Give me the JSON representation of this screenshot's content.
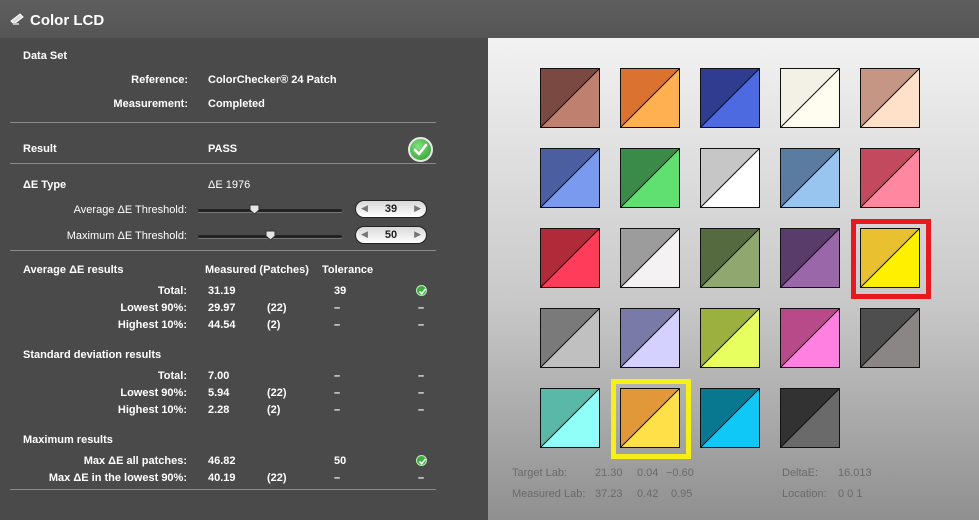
{
  "window": {
    "title": "Color LCD"
  },
  "dataset": {
    "header": "Data Set",
    "reference_label": "Reference:",
    "reference_value": "ColorChecker® 24 Patch",
    "measurement_label": "Measurement:",
    "measurement_value": "Completed"
  },
  "result": {
    "label": "Result",
    "value": "PASS"
  },
  "delta_e": {
    "type_label": "ΔE Type",
    "type_value": "ΔE 1976",
    "avg_threshold_label": "Average  ΔE Threshold:",
    "avg_threshold_value": "39",
    "avg_slider_fraction": 0.39,
    "max_threshold_label": "Maximum ΔE Threshold:",
    "max_threshold_value": "50",
    "max_slider_fraction": 0.5
  },
  "average": {
    "header": "Average ΔE results",
    "col_measured": "Measured (Patches)",
    "col_tolerance": "Tolerance",
    "rows": [
      {
        "label": "Total:",
        "measured": "31.19",
        "patches": "",
        "tolerance": "39",
        "status": "check"
      },
      {
        "label": "Lowest 90%:",
        "measured": "29.97",
        "patches": "(22)",
        "tolerance": "–",
        "status": "–"
      },
      {
        "label": "Highest 10%:",
        "measured": "44.54",
        "patches": "(2)",
        "tolerance": "–",
        "status": "–"
      }
    ]
  },
  "stddev": {
    "header": "Standard deviation results",
    "rows": [
      {
        "label": "Total:",
        "measured": "7.00",
        "patches": "",
        "tolerance": "–",
        "status": "–"
      },
      {
        "label": "Lowest 90%:",
        "measured": "5.94",
        "patches": "(22)",
        "tolerance": "–",
        "status": "–"
      },
      {
        "label": "Highest 10%:",
        "measured": "2.28",
        "patches": "(2)",
        "tolerance": "–",
        "status": "–"
      }
    ]
  },
  "maximum": {
    "header": "Maximum results",
    "rows": [
      {
        "label": "Max ΔE all patches:",
        "measured": "46.82",
        "patches": "",
        "tolerance": "50",
        "status": "check"
      },
      {
        "label": "Max ΔE in the lowest 90%:",
        "measured": "40.19",
        "patches": "(22)",
        "tolerance": "–",
        "status": "–"
      }
    ]
  },
  "patches": [
    {
      "target": "#7a4a42",
      "measured": "#c08070"
    },
    {
      "target": "#dc7230",
      "measured": "#ffb050"
    },
    {
      "target": "#2f3c90",
      "measured": "#4e6ae0"
    },
    {
      "target": "#f3f0e6",
      "measured": "#fffcf0"
    },
    {
      "target": "#c59684",
      "measured": "#ffe0c8"
    },
    {
      "target": "#4a5ea0",
      "measured": "#7a9af0"
    },
    {
      "target": "#3a8a4a",
      "measured": "#60e070"
    },
    {
      "target": "#c6c6c6",
      "measured": "#ffffff"
    },
    {
      "target": "#5a7ca0",
      "measured": "#98c4f0"
    },
    {
      "target": "#c34a5e",
      "measured": "#ff88a0"
    },
    {
      "target": "#b02a3a",
      "measured": "#ff3c5a"
    },
    {
      "target": "#9c9c9c",
      "measured": "#f4f2f2"
    },
    {
      "target": "#566a40",
      "measured": "#90a870"
    },
    {
      "target": "#5a3c6a",
      "measured": "#9a68a8"
    },
    {
      "target": "#e8c030",
      "measured": "#fff000"
    },
    {
      "target": "#7a7a7a",
      "measured": "#c0c0c0"
    },
    {
      "target": "#7a7aa8",
      "measured": "#d4d0ff"
    },
    {
      "target": "#9cb040",
      "measured": "#e8ff60"
    },
    {
      "target": "#b84a8a",
      "measured": "#ff80e0"
    },
    {
      "target": "#4e4e4e",
      "measured": "#8a8686"
    },
    {
      "target": "#5ab8a8",
      "measured": "#90fff8"
    },
    {
      "target": "#e09838",
      "measured": "#ffe048"
    },
    {
      "target": "#087890",
      "measured": "#10c8f8"
    },
    {
      "target": "#323232",
      "measured": "#6a6a6a"
    }
  ],
  "highlights": {
    "red_index": 14,
    "yellow_index": 21
  },
  "info": {
    "target_label": "Target Lab:",
    "target_l": "21.30",
    "target_a": "0.04",
    "target_b": "−0.60",
    "measured_label": "Measured Lab:",
    "measured_l": "37.23",
    "measured_a": "0.42",
    "measured_b": "0.95",
    "deltae_label": "DeltaE:",
    "deltae_value": "16.013",
    "location_label": "Location:",
    "location_value": "0 0 1"
  },
  "colors": {
    "pass_green": "#3bb03b",
    "highlight_red": "#e8191c",
    "highlight_yellow": "#f7ef18"
  }
}
